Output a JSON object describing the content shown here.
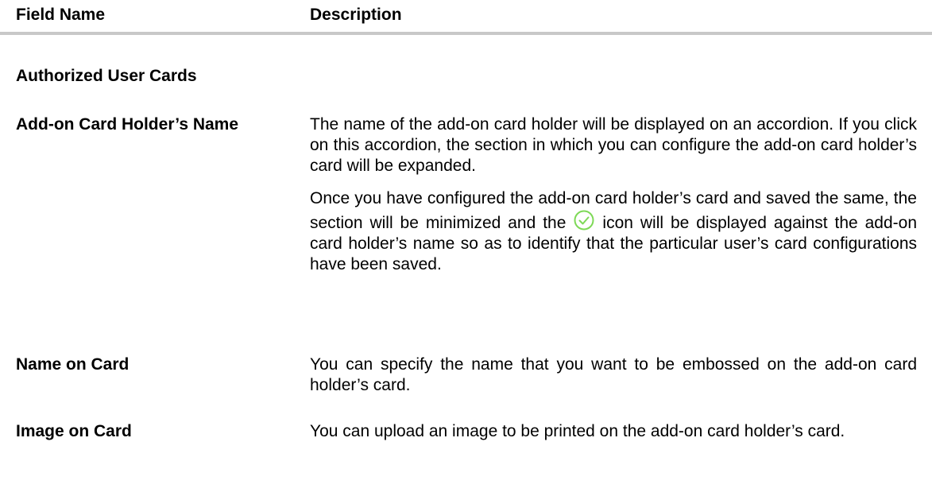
{
  "table": {
    "header": {
      "field_name": "Field Name",
      "description": "Description"
    },
    "section_title": "Authorized User Cards",
    "rows": [
      {
        "label": "Add-on Card Holder’s Name",
        "paragraphs": [
          "The name of the add-on card holder will be displayed on an accordion. If you click on this accordion, the section in which you can configure the add-on card holder’s card will be expanded."
        ],
        "p2_before_icon": "Once you have configured the add-on card holder’s card and saved the same, the section will be minimized and the",
        "p2_after_icon": "icon will be displayed against the add-on card holder’s name so as to identify that the particular user’s card configurations have been saved."
      },
      {
        "label": "Name on Card",
        "paragraphs": [
          "You can specify the name that you want to be embossed on the add-on card holder’s card."
        ]
      },
      {
        "label": "Image on Card",
        "paragraphs": [
          "You can upload an image to be printed on the add-on card holder’s card."
        ]
      }
    ]
  },
  "colors": {
    "rule": "#c8c8c8",
    "check_icon": "#7ed957"
  },
  "icons": {
    "saved_indicator": "circle-check-icon"
  }
}
